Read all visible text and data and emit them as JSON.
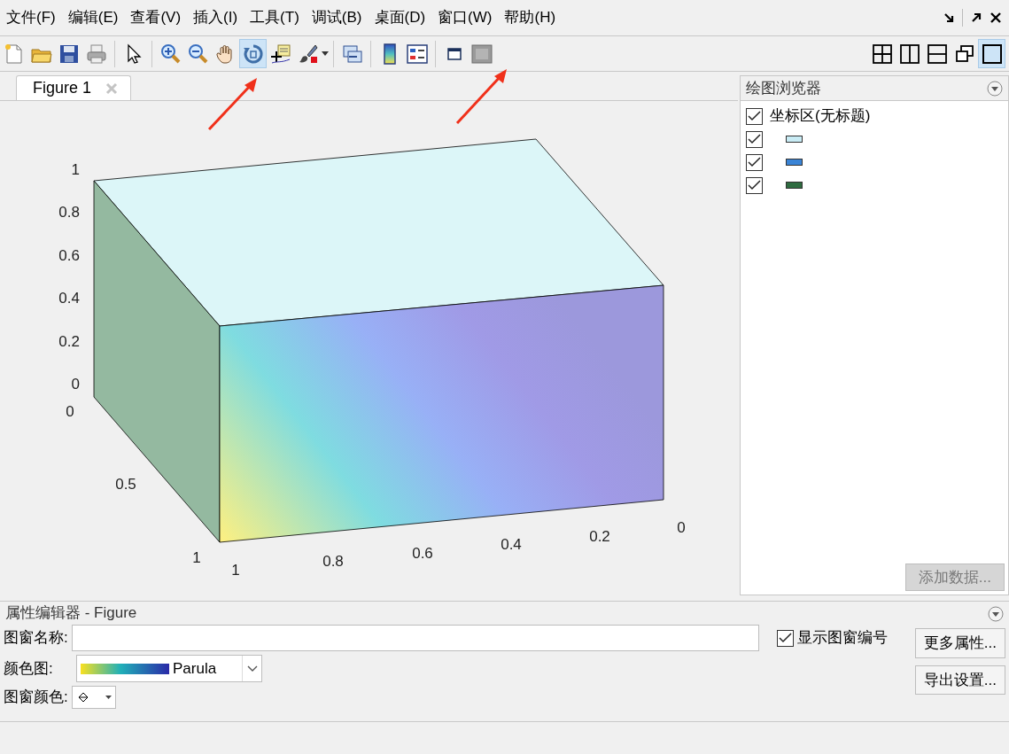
{
  "menu": [
    "文件(F)",
    "编辑(E)",
    "查看(V)",
    "插入(I)",
    "工具(T)",
    "调试(B)",
    "桌面(D)",
    "窗口(W)",
    "帮助(H)"
  ],
  "toolbar": [
    {
      "kind": "new",
      "selected": false
    },
    {
      "kind": "open",
      "selected": false
    },
    {
      "kind": "save",
      "selected": false
    },
    {
      "kind": "print",
      "selected": false
    },
    {
      "kind": "sep"
    },
    {
      "kind": "pointer",
      "selected": false
    },
    {
      "kind": "sep"
    },
    {
      "kind": "zoom-in",
      "selected": false
    },
    {
      "kind": "zoom-out",
      "selected": false
    },
    {
      "kind": "pan",
      "selected": false
    },
    {
      "kind": "rotate",
      "selected": true
    },
    {
      "kind": "datatip",
      "selected": false
    },
    {
      "kind": "brush",
      "selected": false
    },
    {
      "kind": "sep"
    },
    {
      "kind": "link",
      "selected": false
    },
    {
      "kind": "sep"
    },
    {
      "kind": "colorbar",
      "selected": false
    },
    {
      "kind": "legend",
      "selected": false
    },
    {
      "kind": "sep"
    },
    {
      "kind": "window",
      "selected": false
    },
    {
      "kind": "panel",
      "selected": false
    }
  ],
  "layout_buttons": [
    {
      "kind": "grid",
      "selected": false
    },
    {
      "kind": "cols",
      "selected": false
    },
    {
      "kind": "rows",
      "selected": false
    },
    {
      "kind": "float",
      "selected": false
    },
    {
      "kind": "max",
      "selected": true
    }
  ],
  "figure_tab": {
    "label": "Figure 1"
  },
  "plot": {
    "z_ticks": [
      "1",
      "0.8",
      "0.6",
      "0.4",
      "0.2",
      "0"
    ],
    "y_ticks": [
      "0",
      "0.5",
      "1"
    ],
    "x_ticks": [
      "1",
      "0.8",
      "0.6",
      "0.4",
      "0.2",
      "0"
    ]
  },
  "plot_browser": {
    "title": "绘图浏览器",
    "items": [
      {
        "label": "坐标区(无标题)",
        "checked": true
      },
      {
        "color": "#c9ecf5",
        "checked": true
      },
      {
        "color": "#3a84d6",
        "checked": true
      },
      {
        "color": "#2e6b40",
        "checked": true
      }
    ],
    "add_button": {
      "label": "添加数据...",
      "disabled": true
    }
  },
  "property_editor": {
    "title": "属性编辑器 - Figure",
    "name_label": "图窗名称:",
    "show_number": {
      "label": "显示图窗编号",
      "checked": true
    },
    "colormap_label": "颜色图:",
    "colormap": "Parula",
    "color_label": "图窗颜色:",
    "buttons": [
      "更多属性...",
      "导出设置..."
    ]
  }
}
